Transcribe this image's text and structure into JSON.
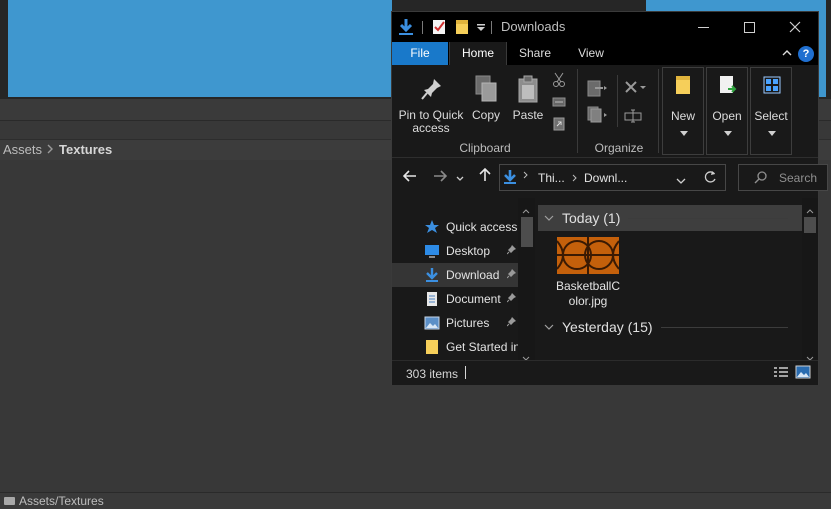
{
  "unity": {
    "breadcrumb": [
      "Assets",
      "Textures"
    ],
    "breadcrumb_separator": ">",
    "status_path": "Assets/Textures"
  },
  "explorer": {
    "title": "Downloads",
    "tabs": [
      "File",
      "Home",
      "Share",
      "View"
    ],
    "help_label": "?",
    "ribbon": {
      "pin_label_line1": "Pin to Quick",
      "pin_label_line2": "access",
      "copy_label": "Copy",
      "paste_label": "Paste",
      "clipboard_group": "Clipboard",
      "organize_group": "Organize",
      "new_label": "New",
      "open_label": "Open",
      "select_label": "Select"
    },
    "address": {
      "segment1": "Thi...",
      "segment2": "Downl...",
      "separator": ">"
    },
    "search_placeholder": "Search",
    "nav_items": [
      {
        "label": "Quick access",
        "icon": "star-icon",
        "pinned": false
      },
      {
        "label": "Desktop",
        "icon": "desktop-icon",
        "pinned": true
      },
      {
        "label": "Download",
        "icon": "download-arrow-icon",
        "pinned": true,
        "selected": true
      },
      {
        "label": "Document",
        "icon": "document-icon",
        "pinned": true
      },
      {
        "label": "Pictures",
        "icon": "pictures-icon",
        "pinned": true
      },
      {
        "label": "Get Started in",
        "icon": "folder-icon",
        "pinned": false
      }
    ],
    "groups": [
      {
        "label": "Today (1)"
      },
      {
        "label": "Yesterday (15)"
      }
    ],
    "files": [
      {
        "name_line1": "BasketballC",
        "name_line2": "olor.jpg"
      }
    ],
    "status": {
      "item_count": "303 items"
    },
    "colors": {
      "accent": "#1979ca",
      "window_bg": "#191919",
      "titlebar_bg": "#000000",
      "basketball": "#c4600b"
    }
  }
}
